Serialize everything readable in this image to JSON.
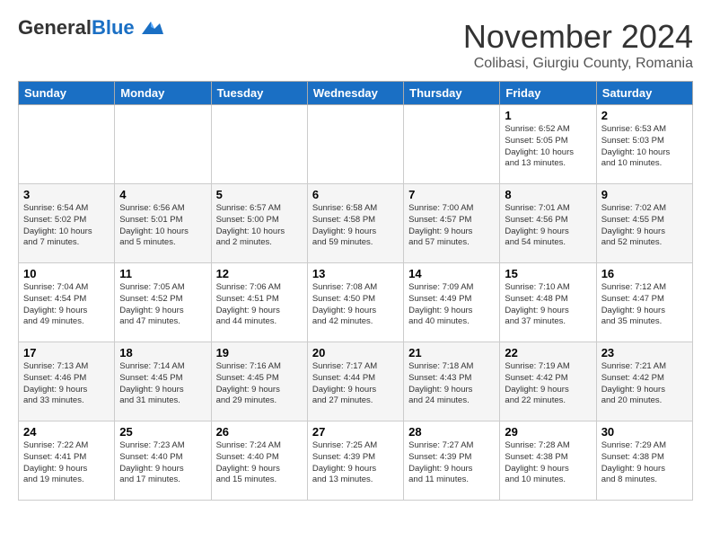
{
  "header": {
    "logo_general": "General",
    "logo_blue": "Blue",
    "month": "November 2024",
    "location": "Colibasi, Giurgiu County, Romania"
  },
  "weekdays": [
    "Sunday",
    "Monday",
    "Tuesday",
    "Wednesday",
    "Thursday",
    "Friday",
    "Saturday"
  ],
  "weeks": [
    [
      {
        "day": "",
        "info": ""
      },
      {
        "day": "",
        "info": ""
      },
      {
        "day": "",
        "info": ""
      },
      {
        "day": "",
        "info": ""
      },
      {
        "day": "",
        "info": ""
      },
      {
        "day": "1",
        "info": "Sunrise: 6:52 AM\nSunset: 5:05 PM\nDaylight: 10 hours\nand 13 minutes."
      },
      {
        "day": "2",
        "info": "Sunrise: 6:53 AM\nSunset: 5:03 PM\nDaylight: 10 hours\nand 10 minutes."
      }
    ],
    [
      {
        "day": "3",
        "info": "Sunrise: 6:54 AM\nSunset: 5:02 PM\nDaylight: 10 hours\nand 7 minutes."
      },
      {
        "day": "4",
        "info": "Sunrise: 6:56 AM\nSunset: 5:01 PM\nDaylight: 10 hours\nand 5 minutes."
      },
      {
        "day": "5",
        "info": "Sunrise: 6:57 AM\nSunset: 5:00 PM\nDaylight: 10 hours\nand 2 minutes."
      },
      {
        "day": "6",
        "info": "Sunrise: 6:58 AM\nSunset: 4:58 PM\nDaylight: 9 hours\nand 59 minutes."
      },
      {
        "day": "7",
        "info": "Sunrise: 7:00 AM\nSunset: 4:57 PM\nDaylight: 9 hours\nand 57 minutes."
      },
      {
        "day": "8",
        "info": "Sunrise: 7:01 AM\nSunset: 4:56 PM\nDaylight: 9 hours\nand 54 minutes."
      },
      {
        "day": "9",
        "info": "Sunrise: 7:02 AM\nSunset: 4:55 PM\nDaylight: 9 hours\nand 52 minutes."
      }
    ],
    [
      {
        "day": "10",
        "info": "Sunrise: 7:04 AM\nSunset: 4:54 PM\nDaylight: 9 hours\nand 49 minutes."
      },
      {
        "day": "11",
        "info": "Sunrise: 7:05 AM\nSunset: 4:52 PM\nDaylight: 9 hours\nand 47 minutes."
      },
      {
        "day": "12",
        "info": "Sunrise: 7:06 AM\nSunset: 4:51 PM\nDaylight: 9 hours\nand 44 minutes."
      },
      {
        "day": "13",
        "info": "Sunrise: 7:08 AM\nSunset: 4:50 PM\nDaylight: 9 hours\nand 42 minutes."
      },
      {
        "day": "14",
        "info": "Sunrise: 7:09 AM\nSunset: 4:49 PM\nDaylight: 9 hours\nand 40 minutes."
      },
      {
        "day": "15",
        "info": "Sunrise: 7:10 AM\nSunset: 4:48 PM\nDaylight: 9 hours\nand 37 minutes."
      },
      {
        "day": "16",
        "info": "Sunrise: 7:12 AM\nSunset: 4:47 PM\nDaylight: 9 hours\nand 35 minutes."
      }
    ],
    [
      {
        "day": "17",
        "info": "Sunrise: 7:13 AM\nSunset: 4:46 PM\nDaylight: 9 hours\nand 33 minutes."
      },
      {
        "day": "18",
        "info": "Sunrise: 7:14 AM\nSunset: 4:45 PM\nDaylight: 9 hours\nand 31 minutes."
      },
      {
        "day": "19",
        "info": "Sunrise: 7:16 AM\nSunset: 4:45 PM\nDaylight: 9 hours\nand 29 minutes."
      },
      {
        "day": "20",
        "info": "Sunrise: 7:17 AM\nSunset: 4:44 PM\nDaylight: 9 hours\nand 27 minutes."
      },
      {
        "day": "21",
        "info": "Sunrise: 7:18 AM\nSunset: 4:43 PM\nDaylight: 9 hours\nand 24 minutes."
      },
      {
        "day": "22",
        "info": "Sunrise: 7:19 AM\nSunset: 4:42 PM\nDaylight: 9 hours\nand 22 minutes."
      },
      {
        "day": "23",
        "info": "Sunrise: 7:21 AM\nSunset: 4:42 PM\nDaylight: 9 hours\nand 20 minutes."
      }
    ],
    [
      {
        "day": "24",
        "info": "Sunrise: 7:22 AM\nSunset: 4:41 PM\nDaylight: 9 hours\nand 19 minutes."
      },
      {
        "day": "25",
        "info": "Sunrise: 7:23 AM\nSunset: 4:40 PM\nDaylight: 9 hours\nand 17 minutes."
      },
      {
        "day": "26",
        "info": "Sunrise: 7:24 AM\nSunset: 4:40 PM\nDaylight: 9 hours\nand 15 minutes."
      },
      {
        "day": "27",
        "info": "Sunrise: 7:25 AM\nSunset: 4:39 PM\nDaylight: 9 hours\nand 13 minutes."
      },
      {
        "day": "28",
        "info": "Sunrise: 7:27 AM\nSunset: 4:39 PM\nDaylight: 9 hours\nand 11 minutes."
      },
      {
        "day": "29",
        "info": "Sunrise: 7:28 AM\nSunset: 4:38 PM\nDaylight: 9 hours\nand 10 minutes."
      },
      {
        "day": "30",
        "info": "Sunrise: 7:29 AM\nSunset: 4:38 PM\nDaylight: 9 hours\nand 8 minutes."
      }
    ]
  ]
}
